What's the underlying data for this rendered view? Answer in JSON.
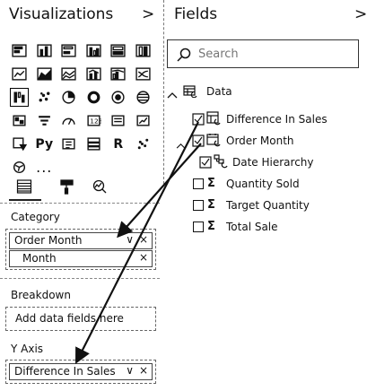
{
  "visualizations": {
    "title": "Visualizations",
    "collapse_glyph": ">",
    "text_icons": {
      "python": "Py",
      "r": "R",
      "more": "..."
    }
  },
  "fields": {
    "title": "Fields",
    "collapse_glyph": ">",
    "search_placeholder": "Search",
    "table": {
      "name": "Data"
    },
    "items": [
      {
        "label": "Difference In Sales",
        "checked": true
      },
      {
        "label": "Order Month",
        "checked": true
      },
      {
        "label": "Date Hierarchy",
        "checked": true
      },
      {
        "label": "Quantity Sold",
        "checked": false
      },
      {
        "label": "Target Quantity",
        "checked": false
      },
      {
        "label": "Total Sale",
        "checked": false
      }
    ],
    "sigma": "Σ"
  },
  "wells": {
    "category": {
      "label": "Category",
      "fields": [
        "Order Month",
        "Month"
      ]
    },
    "breakdown": {
      "label": "Breakdown",
      "placeholder": "Add data fields here"
    },
    "y_axis": {
      "label": "Y Axis",
      "fields": [
        "Difference In Sales"
      ]
    },
    "chevron": "∨",
    "remove": "×"
  },
  "colors": {
    "text": "#111111",
    "border": "#444444",
    "background": "#ffffff"
  }
}
